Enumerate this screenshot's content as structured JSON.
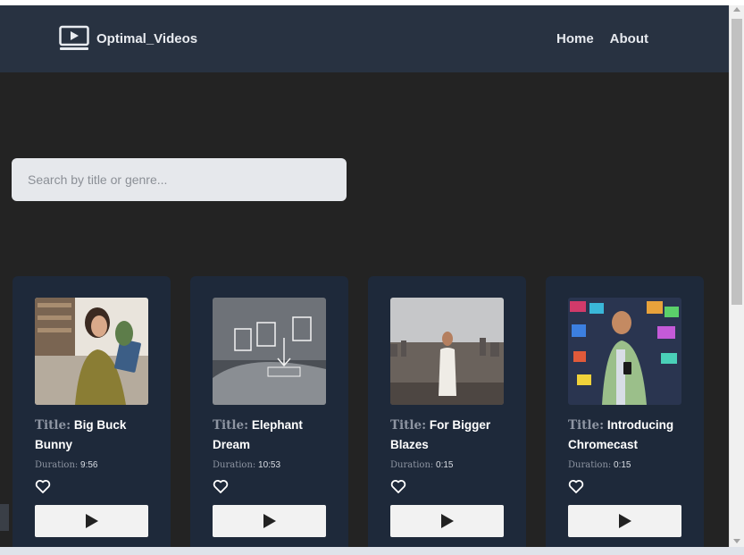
{
  "navbar": {
    "brand": "Optimal_Videos",
    "brand_icon": "video-player-icon",
    "links": [
      "Home",
      "About"
    ]
  },
  "search": {
    "placeholder": "Search by title or genre...",
    "value": ""
  },
  "videos": [
    {
      "title_key": "Title:",
      "title": "Big Buck Bunny",
      "duration_key": "Duration:",
      "duration": "9:56",
      "thumb": "woman-with-tablet"
    },
    {
      "title_key": "Title:",
      "title": "Elephant Dream",
      "duration_key": "Duration:",
      "duration": "10:53",
      "thumb": "laptop-document-upload"
    },
    {
      "title_key": "Title:",
      "title": "For Bigger Blazes",
      "duration_key": "Duration:",
      "duration": "0:15",
      "thumb": "woman-on-rooftop-city"
    },
    {
      "title_key": "Title:",
      "title": "Introducing Chromecast",
      "duration_key": "Duration:",
      "duration": "0:15",
      "thumb": "man-with-phone-screens"
    }
  ],
  "icons": {
    "favorite": "heart-outline-icon",
    "play": "play-icon"
  },
  "colors": {
    "navbar": "#283241",
    "background": "#232323",
    "card": "#1e293a"
  }
}
